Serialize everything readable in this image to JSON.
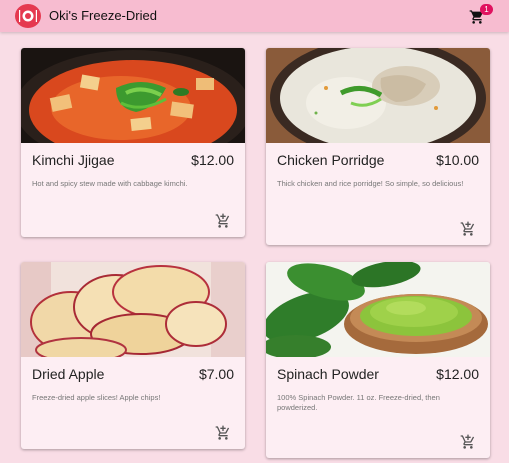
{
  "app": {
    "title": "Oki's Freeze-Dried",
    "cart_count": "1"
  },
  "products": [
    {
      "name": "Kimchi Jjigae",
      "price": "$12.00",
      "description": "Hot and spicy stew made with cabbage kimchi."
    },
    {
      "name": "Chicken Porridge",
      "price": "$10.00",
      "description": "Thick chicken and rice porridge! So simple, so delicious!"
    },
    {
      "name": "Dried Apple",
      "price": "$7.00",
      "description": "Freeze-dried apple slices! Apple chips!"
    },
    {
      "name": "Spinach Powder",
      "price": "$12.00",
      "description": "100% Spinach Powder. 11 oz. Freeze-dried, then powderized."
    }
  ],
  "icons": {
    "logo": "plate-icon",
    "cart": "shopping-cart-icon",
    "add": "add-to-cart-icon"
  },
  "colors": {
    "appbar": "#f7bcd0",
    "background": "#f9dde6",
    "badge": "#e0115f"
  }
}
